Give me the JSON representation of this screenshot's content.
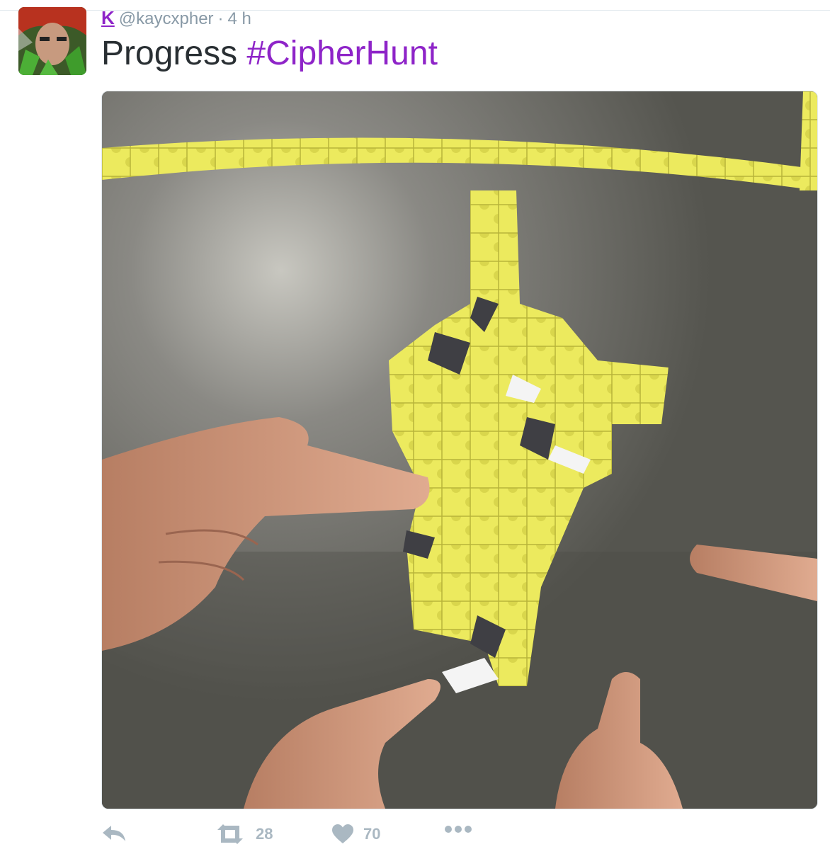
{
  "tweet": {
    "author_name": "K",
    "handle": "@kaycxpher",
    "separator": "·",
    "time": "4 h",
    "text": "Progress",
    "hashtag": "#CipherHunt",
    "media_icon": "photo-jigsaw-puzzle-hands",
    "stats": {
      "retweets": "28",
      "likes": "70"
    },
    "icons": {
      "reply": "reply-icon",
      "retweet": "retweet-icon",
      "like": "heart-icon",
      "more": "more-icon"
    },
    "colors": {
      "accent": "#8e24c8",
      "muted": "#8899a6",
      "text": "#292f33",
      "action": "#aab8c2"
    }
  }
}
